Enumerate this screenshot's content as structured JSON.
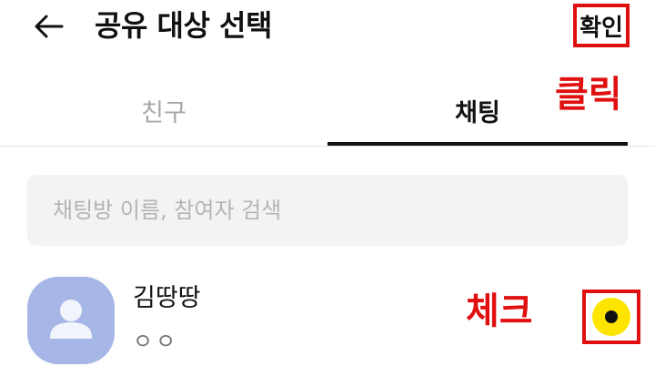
{
  "header": {
    "back_icon": "arrow-left-icon",
    "title": "공유 대상 선택",
    "confirm_label": "확인"
  },
  "annotations": {
    "click": "클릭",
    "check": "체크",
    "color": "#e01010"
  },
  "tabs": [
    {
      "label": "친구",
      "selected": false
    },
    {
      "label": "채팅",
      "selected": true
    }
  ],
  "search": {
    "placeholder": "채팅방 이름, 참여자 검색",
    "value": ""
  },
  "chat_list": [
    {
      "name": "김땅땅",
      "sub": "ㅇㅇ",
      "avatar_icon": "person-icon",
      "avatar_color": "#a6b6e6",
      "selected": true,
      "check_color": "#fee500"
    }
  ]
}
